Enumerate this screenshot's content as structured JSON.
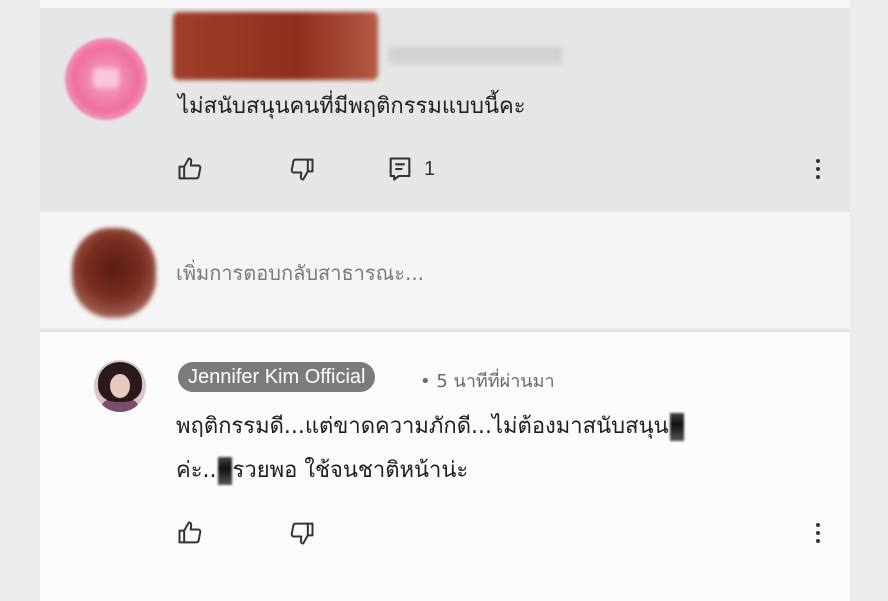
{
  "colors": {
    "page_bg": "#ebebeb",
    "comment_bg": "#e6e6e6",
    "reply_box_bg": "#f5f5f5",
    "reply_comment_bg": "#fbfbfb",
    "badge_bg": "#7b7b7b",
    "text": "#1e1e1e"
  },
  "top_comment": {
    "text": "ไม่สนับสนุนคนที่มีพฤติกรรมแบบนี้คะ",
    "reply_count": "1",
    "icons": [
      "like-icon",
      "dislike-icon",
      "reply-icon",
      "more-vert-icon"
    ]
  },
  "reply_box": {
    "placeholder": "เพิ่มการตอบกลับสาธารณะ..."
  },
  "reply_comment": {
    "author": "Jennifer Kim Official",
    "time": "• 5 นาทีที่ผ่านมา",
    "line1_part1": "พฤติกรรมดี...แต่ขาดความภักดี...ไม่ต้องมาสนับสนุน",
    "line2_part1": "ค่ะ..",
    "line2_part2": "รวยพอ ใช้จนชาติหน้าน่ะ",
    "icons": [
      "like-icon",
      "dislike-icon",
      "more-vert-icon"
    ]
  }
}
